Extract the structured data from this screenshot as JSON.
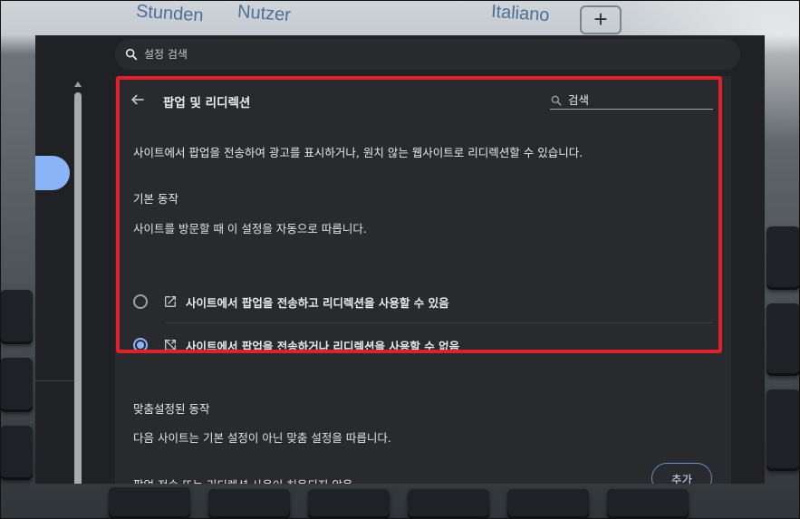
{
  "background": {
    "words": [
      "Stunden",
      "Nutzer",
      "Italiano"
    ],
    "plus_glyph": "+"
  },
  "search": {
    "placeholder": "설정 검색",
    "icon": "search-icon"
  },
  "page": {
    "title": "팝업 및 리디렉션",
    "back_icon": "arrow-back-icon",
    "search_placeholder": "검색",
    "description": "사이트에서 팝업을 전송하여 광고를 표시하거나, 원치 않는 웹사이트로 리디렉션할 수 있습니다.",
    "default_behavior": {
      "heading": "기본 동작",
      "subtext": "사이트를 방문할 때 이 설정을 자동으로 따릅니다.",
      "options": [
        {
          "label": "사이트에서 팝업을 전송하고 리디렉션을 사용할 수 있음",
          "icon": "open-in-new-icon",
          "selected": false
        },
        {
          "label": "사이트에서 팝업을 전송하거나 리디렉션을 사용할 수 없음",
          "icon": "open-in-new-off-icon",
          "selected": true
        }
      ]
    },
    "custom_behavior": {
      "heading": "맞춤설정된 동작",
      "subtext": "다음 사이트는 기본 설정이 아닌 맞춤 설정을 따릅니다.",
      "block_list_label": "팝업 전송 또는 리디렉션 사용이 허용되지 않음",
      "add_button": "추가"
    }
  },
  "colors": {
    "accent": "#8ab4f8",
    "highlight": "#e0202a",
    "surface": "#292a2d",
    "window_bg": "#202124"
  }
}
